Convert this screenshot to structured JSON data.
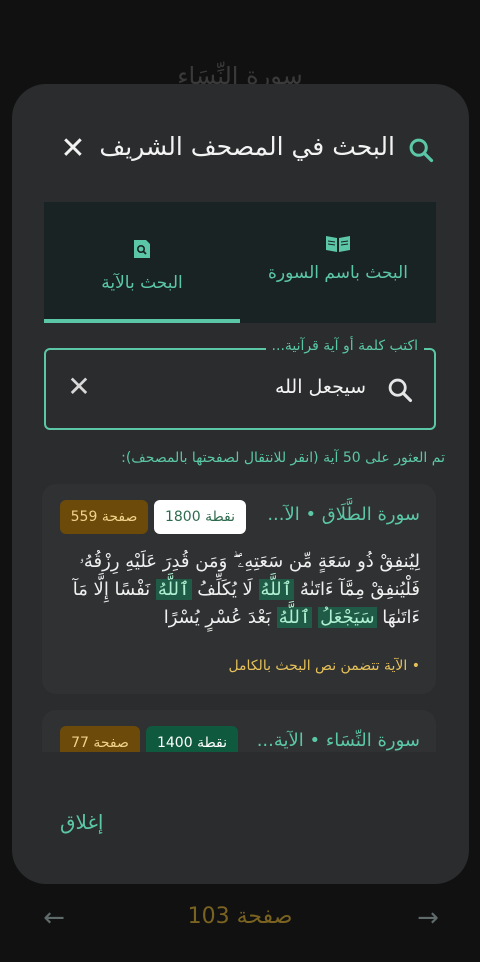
{
  "background": {
    "surah_header": "سورة النِّسَاء",
    "page_label": "صفحة 103",
    "prev_icon": "arrow-left-icon",
    "next_icon": "arrow-right-icon"
  },
  "modal": {
    "title": "البحث في المصحف الشريف",
    "close_icon": "✕",
    "tabs": [
      {
        "label": "البحث بالآية",
        "icon": "search-doc-icon",
        "active": true
      },
      {
        "label": "البحث باسم السورة",
        "icon": "book-icon",
        "active": false
      }
    ],
    "search": {
      "placeholder": "اكتب كلمة أو آية قرآنية...",
      "value": "سيجعل الله",
      "clear_icon": "✕"
    },
    "results_count": "تم العثور على 50 آية (انقر للانتقال لصفحتها بالمصحف):",
    "results": [
      {
        "surah": "سورة الطَّلَاق • الآ...",
        "points": "1800 نقطة",
        "page": "صفحة 559",
        "verse_parts": [
          "لِيُنفِقْ ذُو سَعَةٍ مِّن سَعَتِهِۦ ۖ وَمَن قُدِرَ عَلَيْهِ رِزْقُهُۥ فَلْيُنفِقْ مِمَّآ ءَاتَىٰهُ ",
          "ٱللَّهُ",
          " لَا يُكَلِّفُ ",
          "ٱللَّهُ",
          " نَفْسًا إِلَّا مَآ ءَاتَىٰهَا ",
          "سَيَجْعَلُ",
          " ",
          "ٱللَّهُ",
          " بَعْدَ عُسْرٍ يُسْرًا"
        ],
        "match_note": "• الآية تتضمن نص البحث بالكامل"
      },
      {
        "surah": "سورة النِّسَاء • الآية...",
        "points": "1400 نقطة",
        "page": "صفحة 77"
      }
    ],
    "close_label": "إغلاق"
  }
}
